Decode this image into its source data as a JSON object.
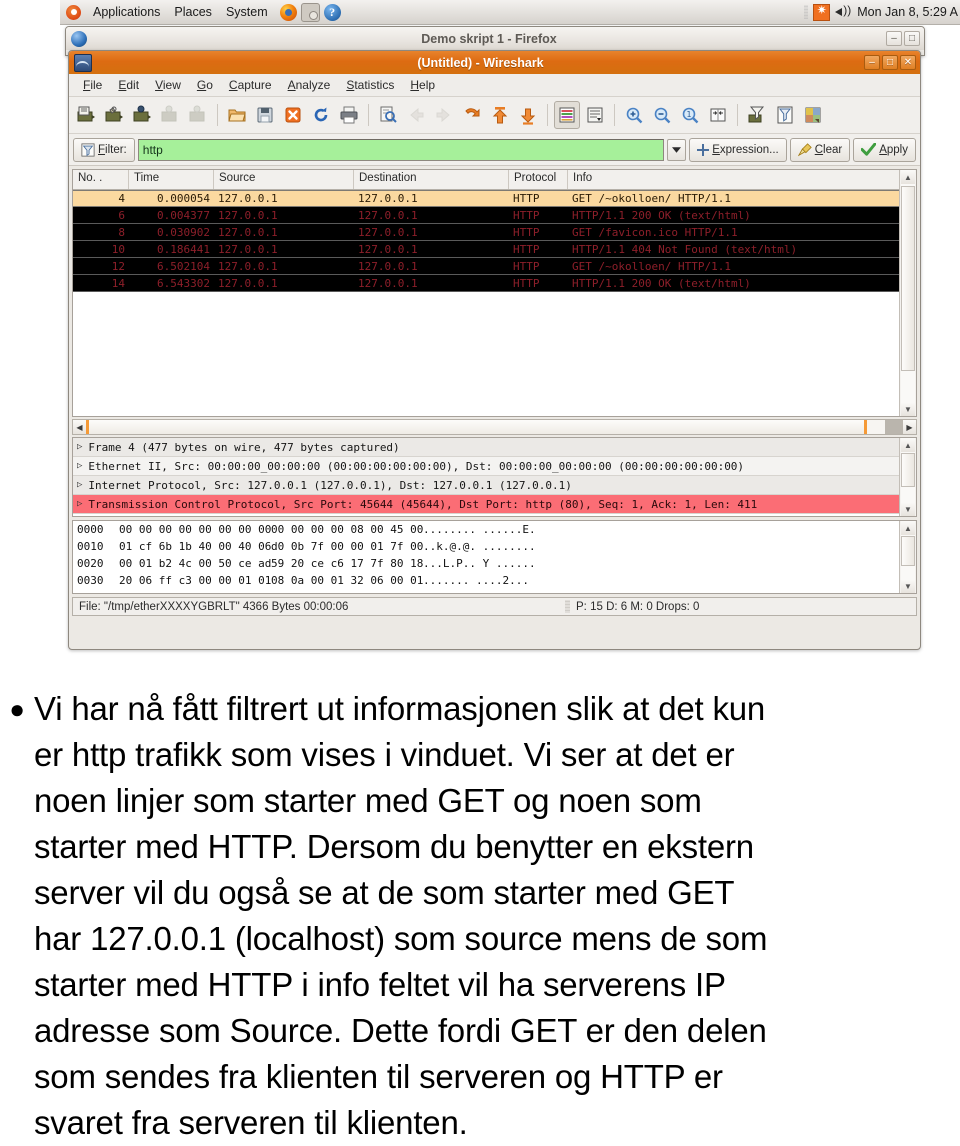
{
  "desktop": {
    "panel": {
      "menus": [
        "Applications",
        "Places",
        "System"
      ],
      "launchers": [
        "firefox-icon",
        "evolution-icon",
        "help-icon"
      ],
      "tray": [
        "update-manager-icon",
        "volume-icon"
      ],
      "clock": "Mon Jan 8,  5:29 A"
    }
  },
  "firefox_window": {
    "title": "Demo skript 1 - Firefox",
    "icon": "firefox-globe-icon",
    "buttons": {
      "minimize": "–",
      "maximize": "□"
    }
  },
  "wireshark_window": {
    "title": "(Untitled) - Wireshark",
    "icon": "wireshark-icon",
    "buttons": {
      "minimize": "–",
      "maximize": "□",
      "close": "✕"
    },
    "menubar": [
      {
        "label": "File",
        "accel": "F"
      },
      {
        "label": "Edit",
        "accel": "E"
      },
      {
        "label": "View",
        "accel": "V"
      },
      {
        "label": "Go",
        "accel": "G"
      },
      {
        "label": "Capture",
        "accel": "C"
      },
      {
        "label": "Analyze",
        "accel": "A"
      },
      {
        "label": "Statistics",
        "accel": "S"
      },
      {
        "label": "Help",
        "accel": "H"
      }
    ],
    "toolbar": [
      "list-interfaces-icon",
      "capture-options-icon",
      "start-capture-icon",
      "stop-capture-icon",
      "restart-capture-icon",
      "open-file-icon",
      "save-file-icon",
      "close-file-icon",
      "reload-icon",
      "print-icon",
      "find-packet-icon",
      "go-back-icon",
      "go-forward-icon",
      "go-to-packet-icon",
      "go-first-packet-icon",
      "go-last-packet-icon",
      "colorize-icon",
      "auto-scroll-icon",
      "zoom-in-icon",
      "zoom-out-icon",
      "zoom-normal-icon",
      "resize-columns-icon",
      "capture-filters-icon",
      "display-filters-icon",
      "coloring-rules-icon"
    ],
    "filterbar": {
      "filter_button_label": "Filter:",
      "filter_button_accel": "F",
      "filter_icon": "filter-funnel-icon",
      "filter_value": "http",
      "filter_placeholder": "",
      "dropdown_icon": "chevron-down-icon",
      "expression_label": "Expression...",
      "expression_accel": "E",
      "expression_icon": "plus-icon",
      "clear_label": "Clear",
      "clear_accel": "C",
      "clear_icon": "broom-icon",
      "apply_label": "Apply",
      "apply_accel": "A",
      "apply_icon": "check-icon"
    },
    "packet_list": {
      "columns": [
        "No. .",
        "Time",
        "Source",
        "Destination",
        "Protocol",
        "Info"
      ],
      "rows": [
        {
          "no": "4",
          "time": "0.000054",
          "source": "127.0.0.1",
          "destination": "127.0.0.1",
          "protocol": "HTTP",
          "info": "GET /~okolloen/ HTTP/1.1",
          "selected": true
        },
        {
          "no": "6",
          "time": "0.004377",
          "source": "127.0.0.1",
          "destination": "127.0.0.1",
          "protocol": "HTTP",
          "info": "HTTP/1.1 200 OK  (text/html)",
          "selected": false
        },
        {
          "no": "8",
          "time": "0.030902",
          "source": "127.0.0.1",
          "destination": "127.0.0.1",
          "protocol": "HTTP",
          "info": "GET /favicon.ico HTTP/1.1",
          "selected": false
        },
        {
          "no": "10",
          "time": "0.186441",
          "source": "127.0.0.1",
          "destination": "127.0.0.1",
          "protocol": "HTTP",
          "info": "HTTP/1.1 404 Not Found  (text/html)",
          "selected": false
        },
        {
          "no": "12",
          "time": "6.502104",
          "source": "127.0.0.1",
          "destination": "127.0.0.1",
          "protocol": "HTTP",
          "info": "GET /~okolloen/ HTTP/1.1",
          "selected": false
        },
        {
          "no": "14",
          "time": "6.543302",
          "source": "127.0.0.1",
          "destination": "127.0.0.1",
          "protocol": "HTTP",
          "info": "HTTP/1.1 200 OK  (text/html)",
          "selected": false
        }
      ]
    },
    "packet_details": {
      "rows": [
        {
          "text": "Frame 4 (477 bytes on wire, 477 bytes captured)",
          "state": "collapsed"
        },
        {
          "text": "Ethernet II, Src: 00:00:00_00:00:00 (00:00:00:00:00:00), Dst: 00:00:00_00:00:00 (00:00:00:00:00:00)",
          "state": "collapsed"
        },
        {
          "text": "Internet Protocol, Src: 127.0.0.1 (127.0.0.1), Dst: 127.0.0.1 (127.0.0.1)",
          "state": "collapsed"
        },
        {
          "text": "Transmission Control Protocol, Src Port: 45644 (45644), Dst Port: http (80), Seq: 1, Ack: 1, Len: 411",
          "state": "collapsed"
        }
      ]
    },
    "packet_bytes": {
      "rows": [
        {
          "offset": "0000",
          "bytes1": "00 00 00 00 00 00 00 00",
          "bytes2": "00 00 00 00 08 00 45 00",
          "ascii": "........ ......E."
        },
        {
          "offset": "0010",
          "bytes1": "01 cf 6b 1b 40 00 40 06",
          "bytes2": "d0 0b 7f 00 00 01 7f 00",
          "ascii": "..k.@.@. ........"
        },
        {
          "offset": "0020",
          "bytes1": "00 01 b2 4c 00 50 ce ad",
          "bytes2": "59 20 ce c6 17 7f 80 18",
          "ascii": "...L.P.. Y ......"
        },
        {
          "offset": "0030",
          "bytes1": "20 06 ff c3 00 00 01 01",
          "bytes2": "08 0a 00 01 32 06 00 01",
          "ascii": "....... ....2..."
        }
      ]
    },
    "statusbar": {
      "file_info": "File: \"/tmp/etherXXXXYGBRLT\" 4366 Bytes 00:00:06",
      "counts": "P: 15 D: 6 M: 0 Drops: 0"
    }
  },
  "slide": {
    "bullet_marker": "●",
    "lines": [
      "Vi har nå fått filtrert ut informasjonen slik at det kun",
      "er http trafikk som vises i vinduet. Vi ser at det er",
      "noen linjer som starter med GET og noen som",
      "starter med HTTP. Dersom du benytter en ekstern",
      "server vil du også se at de som starter med GET",
      "har 127.0.0.1 (localhost) som source mens de som",
      "starter med HTTP i info feltet vil ha serverens IP",
      "adresse som Source. Dette fordi GET er den delen",
      "som sendes fra klienten til serveren og HTTP er",
      "svaret fra serveren til klienten."
    ]
  },
  "colors": {
    "active_title": "#dd6b12",
    "filter_valid_bg": "#a6f09a",
    "selected_row_bg": "#fbd9a0",
    "packet_row_bg": "#000000",
    "packet_row_fg": "#8d1f2a",
    "tcp_highlight": "#fb6d75"
  }
}
